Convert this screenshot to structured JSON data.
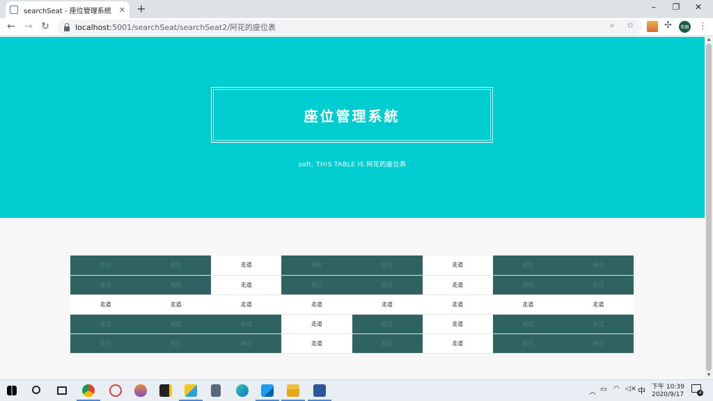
{
  "browser": {
    "tab_title": "searchSeat - 座位管理系統",
    "url_host": "localhost",
    "url_rest": ":5001/searchSeat/searchSeat2/阿花的座位表",
    "avatar_label": "布朗",
    "favicon": "doc-icon",
    "accent": "#1a73e8"
  },
  "page": {
    "hero_title": "座位管理系統",
    "hero_subtitle": "soft, THIS TABLE IS 阿花的座位表",
    "hero_color": "#00cdd0",
    "seat_color": "#2f6361"
  },
  "seats": {
    "seat_label": "座位",
    "aisle_label": "走道",
    "rows": [
      [
        "seat",
        "seat",
        "aisle",
        "seat",
        "seat",
        "aisle",
        "seat",
        "seat"
      ],
      [
        "seat",
        "seat",
        "aisle",
        "seat",
        "seat",
        "aisle",
        "seat",
        "seat"
      ],
      [
        "aisle",
        "aisle",
        "aisle",
        "aisle",
        "aisle",
        "aisle",
        "aisle",
        "aisle"
      ],
      [
        "seat",
        "seat",
        "seat",
        "aisle",
        "seat",
        "aisle",
        "seat",
        "seat"
      ],
      [
        "seat",
        "seat",
        "seat",
        "aisle",
        "seat",
        "aisle",
        "seat",
        "seat"
      ]
    ]
  },
  "taskbar": {
    "ime": "中",
    "time": "下午 10:39",
    "date": "2020/9/17",
    "notifications": "4"
  }
}
